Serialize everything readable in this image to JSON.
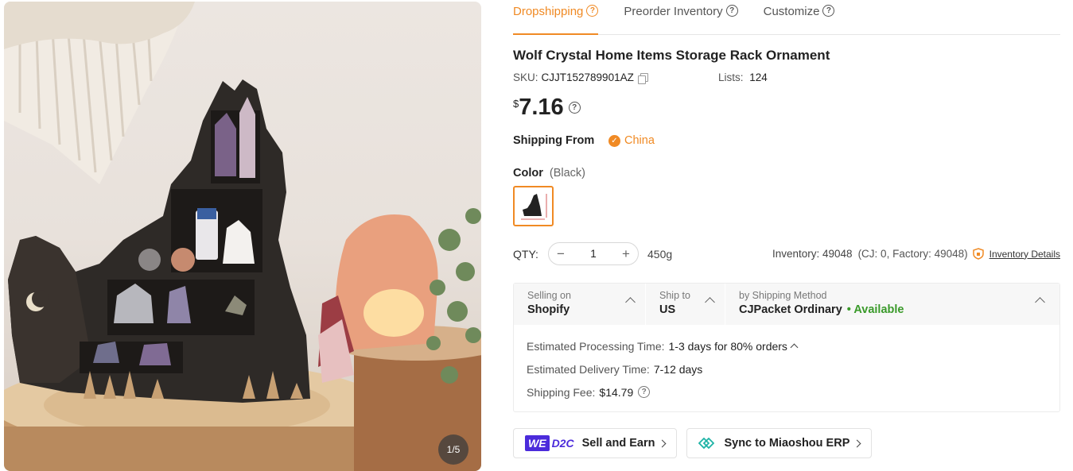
{
  "gallery": {
    "page_indicator": "1/5"
  },
  "tabs": [
    {
      "label": "Dropshipping",
      "active": true
    },
    {
      "label": "Preorder Inventory",
      "active": false
    },
    {
      "label": "Customize",
      "active": false
    }
  ],
  "help_glyph": "?",
  "product": {
    "title": "Wolf Crystal Home Items Storage Rack Ornament",
    "sku_label": "SKU:",
    "sku": "CJJT152789901AZ",
    "lists_label": "Lists:",
    "lists": "124",
    "currency": "$",
    "price": "7.16"
  },
  "shipping_from": {
    "label": "Shipping From",
    "country": "China"
  },
  "color": {
    "label": "Color",
    "selected": "(Black)"
  },
  "quantity": {
    "label": "QTY:",
    "value": "1",
    "decrement": "−",
    "increment": "+",
    "weight": "450g"
  },
  "inventory": {
    "text": "Inventory: 49048",
    "breakdown": "(CJ: 0, Factory: 49048)",
    "details_link": "Inventory Details"
  },
  "shipping": {
    "selling_on_label": "Selling on",
    "selling_on": "Shopify",
    "ship_to_label": "Ship to",
    "ship_to": "US",
    "method_label": "by Shipping Method",
    "method": "CJPacket Ordinary",
    "availability": "• Available",
    "processing_label": "Estimated Processing Time:",
    "processing": "1-3 days for 80% orders",
    "delivery_label": "Estimated Delivery Time:",
    "delivery": "7-12 days",
    "fee_label": "Shipping Fee:",
    "fee": "$14.79"
  },
  "actions": {
    "we": "WE",
    "d2c": "D2C",
    "sell_label": "Sell and Earn",
    "sync_label": "Sync to Miaoshou ERP"
  },
  "colors": {
    "accent": "#f08a24",
    "available": "#3a9a2a",
    "brand_purple": "#4b2bdb"
  }
}
